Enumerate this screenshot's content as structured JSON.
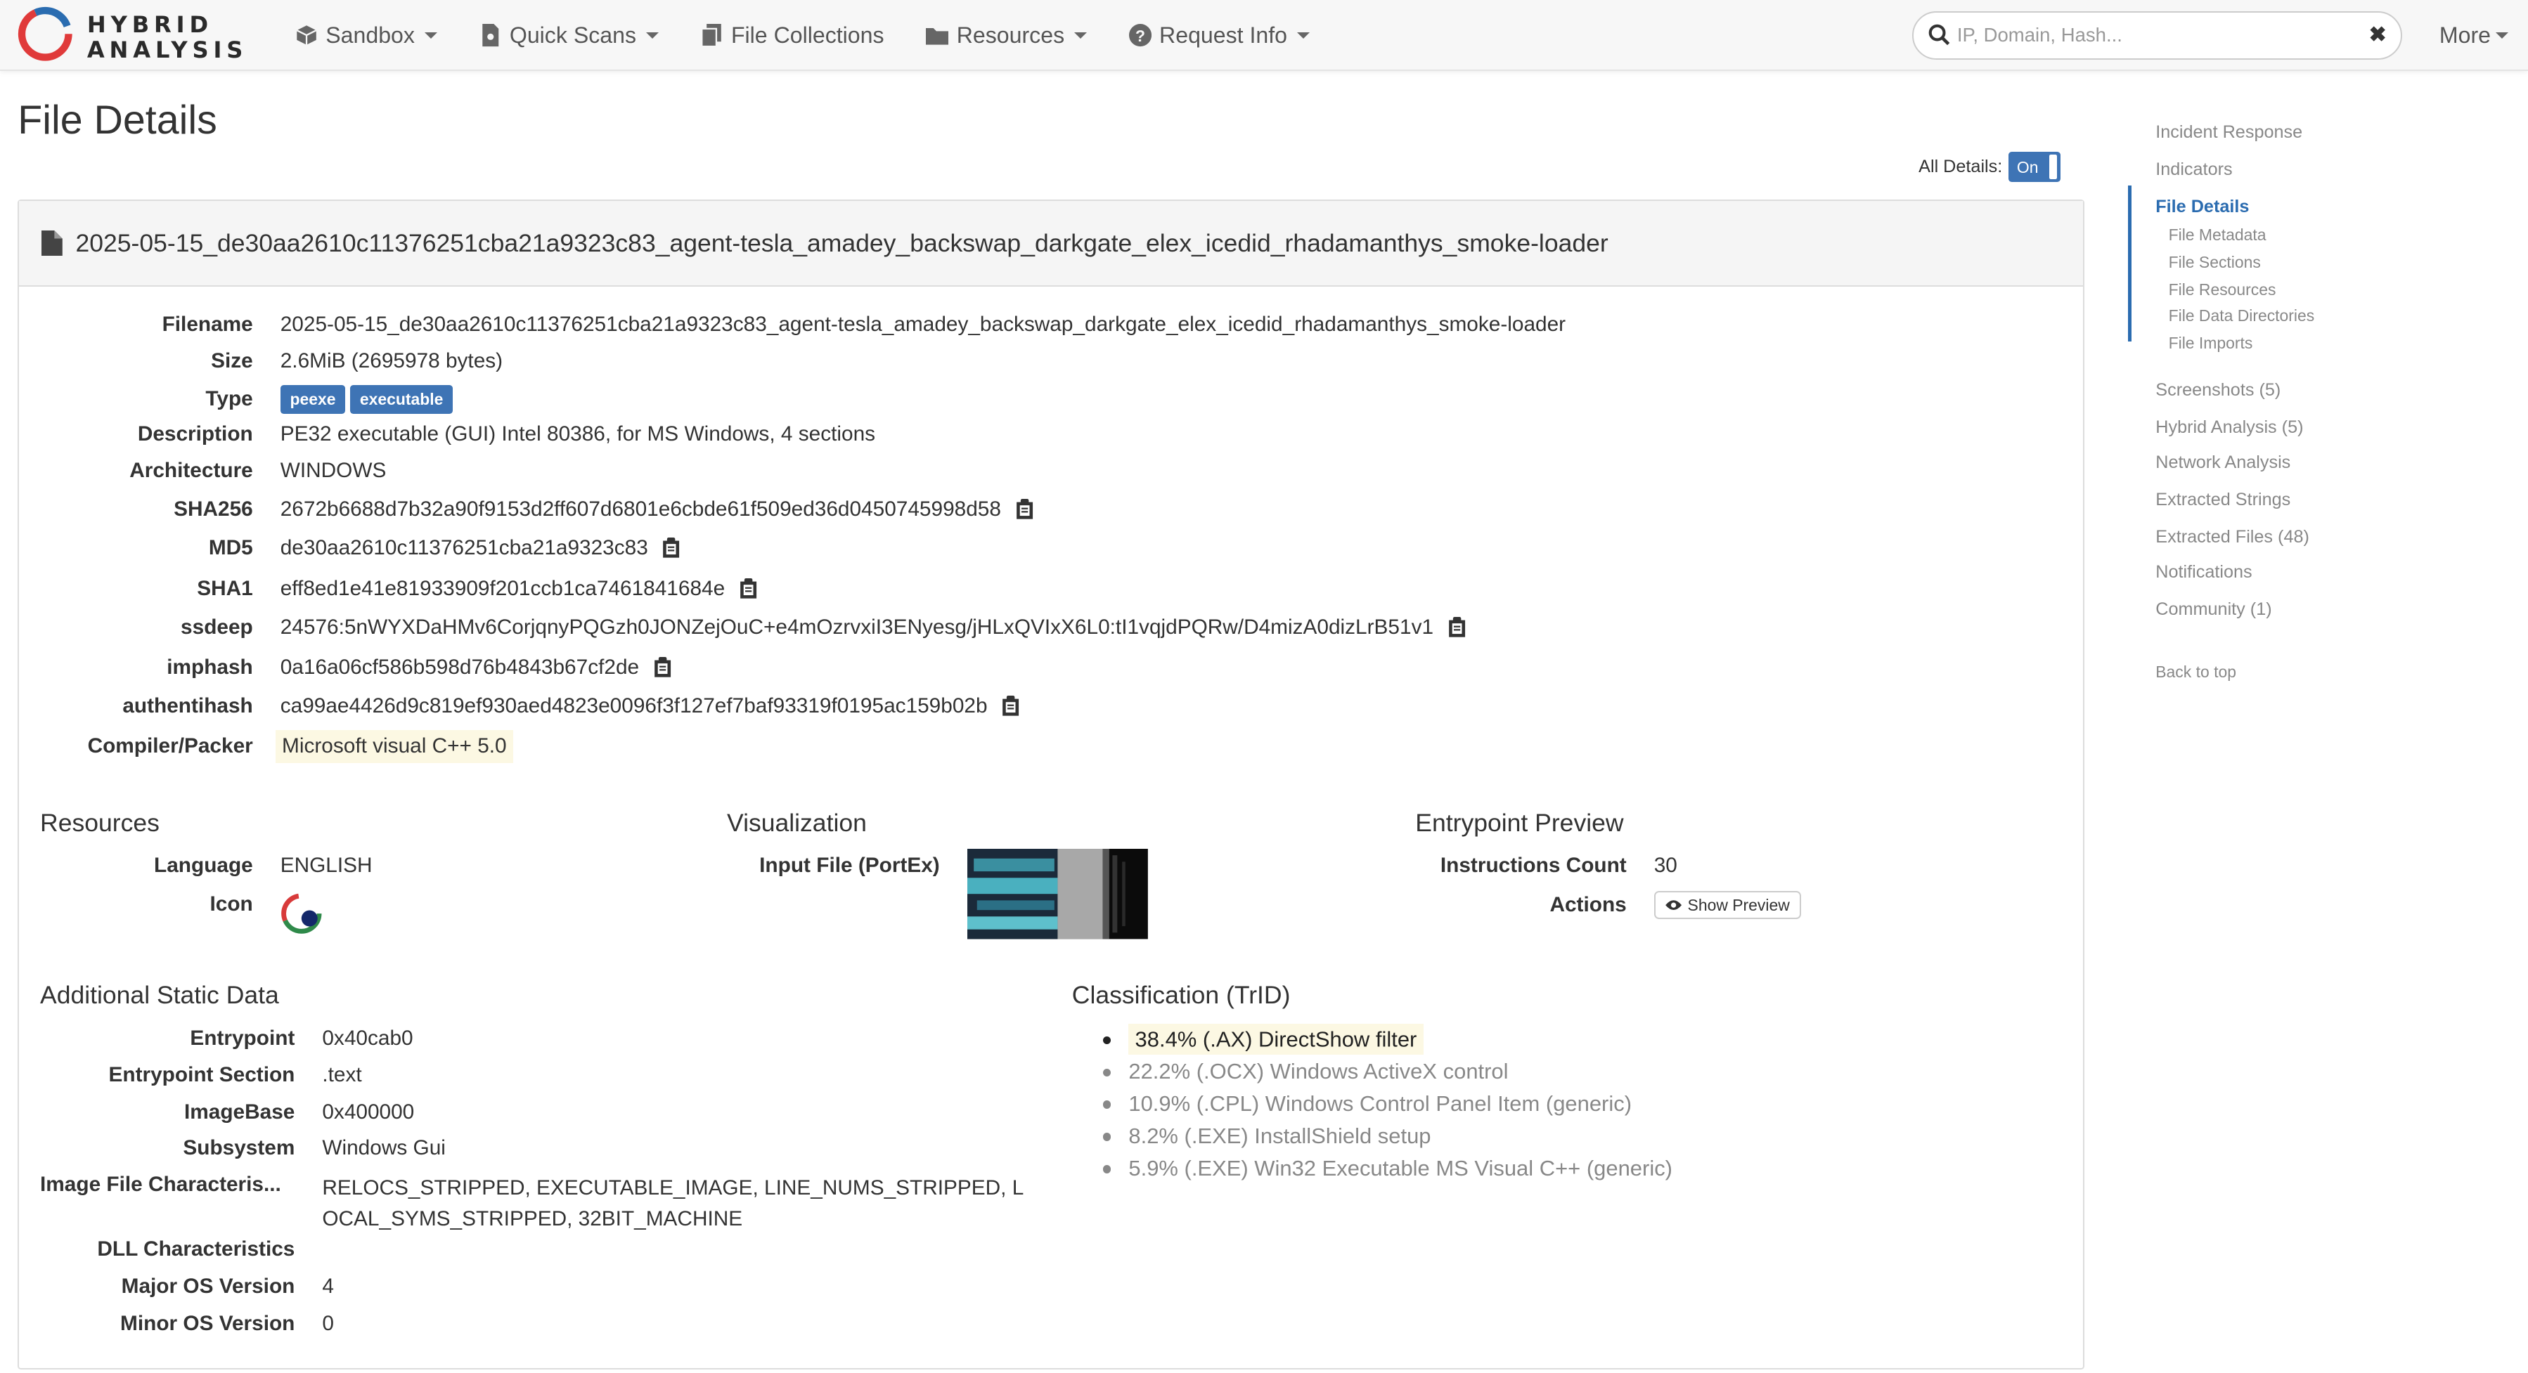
{
  "nav": {
    "brand_line1": "HYBRID",
    "brand_line2": "ANALYSIS",
    "items": [
      {
        "label": "Sandbox",
        "icon": "cube-icon",
        "dropdown": true
      },
      {
        "label": "Quick Scans",
        "icon": "file-scan-icon",
        "dropdown": true
      },
      {
        "label": "File Collections",
        "icon": "files-icon",
        "dropdown": false
      },
      {
        "label": "Resources",
        "icon": "folder-icon",
        "dropdown": true
      },
      {
        "label": "Request Info",
        "icon": "question-circle-icon",
        "dropdown": true
      }
    ],
    "search_placeholder": "IP, Domain, Hash...",
    "search_value": "",
    "more_label": "More",
    "accent": "#3e74b5"
  },
  "page": {
    "title": "File Details",
    "all_details_label": "All Details:",
    "toggle_label": "On"
  },
  "file": {
    "header_name": "2025-05-15_de30aa2610c11376251cba21a9323c83_agent-tesla_amadey_backswap_darkgate_elex_icedid_rhadamanthys_smoke-loader",
    "labels": {
      "filename": "Filename",
      "size": "Size",
      "type": "Type",
      "description": "Description",
      "architecture": "Architecture",
      "sha256": "SHA256",
      "md5": "MD5",
      "sha1": "SHA1",
      "ssdeep": "ssdeep",
      "imphash": "imphash",
      "authentihash": "authentihash",
      "compiler": "Compiler/Packer"
    },
    "filename": "2025-05-15_de30aa2610c11376251cba21a9323c83_agent-tesla_amadey_backswap_darkgate_elex_icedid_rhadamanthys_smoke-loader",
    "size": "2.6MiB (2695978 bytes)",
    "type_badges": [
      "peexe",
      "executable"
    ],
    "description": "PE32 executable (GUI) Intel 80386, for MS Windows, 4 sections",
    "architecture": "WINDOWS",
    "sha256": "2672b6688d7b32a90f9153d2ff607d6801e6cbde61f509ed36d0450745998d58",
    "md5": "de30aa2610c11376251cba21a9323c83",
    "sha1": "eff8ed1e41e81933909f201ccb1ca7461841684e",
    "ssdeep": "24576:5nWYXDaHMv6CorjqnyPQGzh0JONZejOuC+e4mOzrvxiI3ENyesg/jHLxQVIxX6L0:tI1vqjdPQRw/D4mizA0dizLrB51v1",
    "imphash": "0a16a06cf586b598d76b4843b67cf2de",
    "authentihash": "ca99ae4426d9c819ef930aed4823e0096f3f127ef7baf93319f0195ac159b02b",
    "compiler": "Microsoft visual C++ 5.0"
  },
  "resources": {
    "title": "Resources",
    "language_label": "Language",
    "language": "ENGLISH",
    "icon_label": "Icon"
  },
  "visualization": {
    "title": "Visualization",
    "input_label": "Input File (PortEx)"
  },
  "entrypoint": {
    "title": "Entrypoint Preview",
    "count_label": "Instructions Count",
    "count": "30",
    "actions_label": "Actions",
    "button_label": "Show Preview"
  },
  "static": {
    "title": "Additional Static Data",
    "labels": {
      "entrypoint": "Entrypoint",
      "section": "Entrypoint Section",
      "imagebase": "ImageBase",
      "subsystem": "Subsystem",
      "characteristics": "Image File Characteris...",
      "dll": "DLL Characteristics",
      "major": "Major OS Version",
      "minor": "Minor OS Version"
    },
    "entrypoint": "0x40cab0",
    "section": ".text",
    "imagebase": "0x400000",
    "subsystem": "Windows Gui",
    "characteristics_line1": "RELOCS_STRIPPED, EXECUTABLE_IMAGE, LINE_NUMS_STRIPPED, L",
    "characteristics_line2": "OCAL_SYMS_STRIPPED, 32BIT_MACHINE",
    "dll": "",
    "major": "4",
    "minor": "0"
  },
  "trid": {
    "title": "Classification (TrID)",
    "items": [
      "38.4% (.AX) DirectShow filter",
      "22.2% (.OCX) Windows ActiveX control",
      "10.9% (.CPL) Windows Control Panel Item (generic)",
      "8.2% (.EXE) InstallShield setup",
      "5.9% (.EXE) Win32 Executable MS Visual C++ (generic)"
    ]
  },
  "sidenav": {
    "items": [
      "Incident Response",
      "Indicators",
      "File Details",
      "File Metadata",
      "File Sections",
      "File Resources",
      "File Data Directories",
      "File Imports",
      "Screenshots (5)",
      "Hybrid Analysis (5)",
      "Network Analysis",
      "Extracted Strings",
      "Extracted Files (48)",
      "Notifications",
      "Community (1)",
      "Back to top"
    ]
  }
}
